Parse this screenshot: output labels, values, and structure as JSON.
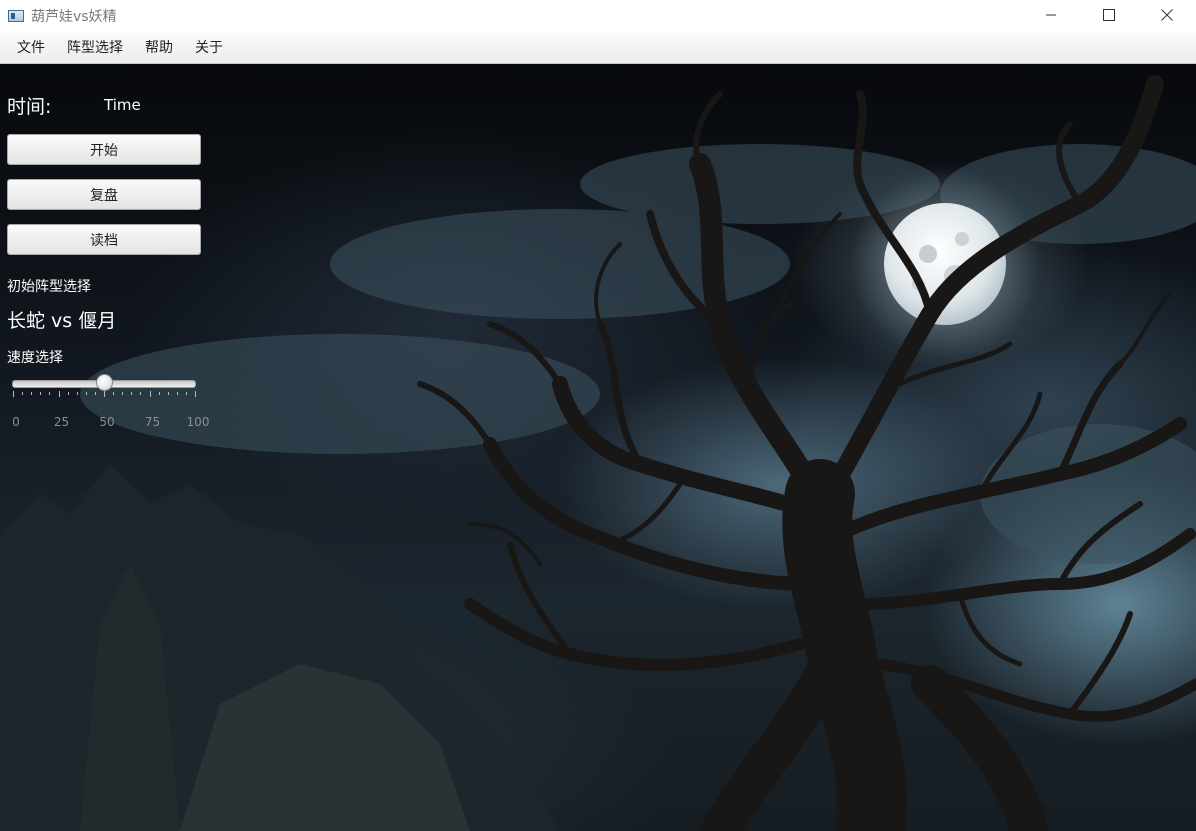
{
  "window": {
    "title": "葫芦娃vs妖精",
    "app_icon": "app-window-icon",
    "controls": [
      "minimize-icon",
      "maximize-icon",
      "close-icon"
    ]
  },
  "menu": {
    "items": [
      {
        "label": "文件"
      },
      {
        "label": "阵型选择"
      },
      {
        "label": "帮助"
      },
      {
        "label": "关于"
      }
    ]
  },
  "panel": {
    "time_label": "时间:",
    "time_value": "Time",
    "buttons": {
      "start": "开始",
      "replay": "复盘",
      "load": "读档"
    },
    "formation_label": "初始阵型选择",
    "formation_value": "长蛇 vs 偃月",
    "speed_label": "速度选择",
    "speed": {
      "value": 50,
      "min": 0,
      "max": 100,
      "tick_labels": [
        "0",
        "25",
        "50",
        "75",
        "100"
      ]
    }
  },
  "background": {
    "description_icon": "moonlit-dead-tree-scene",
    "colors": {
      "moon": "#e8eef2",
      "glow": "#8fb6c9",
      "tree": "#1a1816"
    }
  }
}
